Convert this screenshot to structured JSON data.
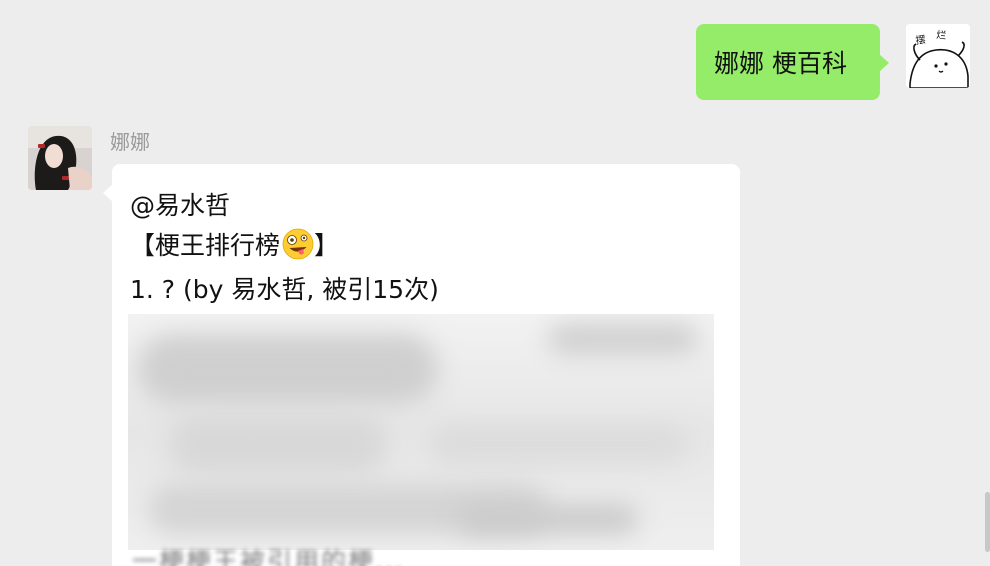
{
  "outgoing": {
    "text": "娜娜  梗百科",
    "avatar_label": "摆烂"
  },
  "incoming": {
    "sender_name": "娜娜",
    "line1": "@易水哲",
    "line2": "【梗王排行榜",
    "line2_emoji": "zany-face-emoji",
    "line2_end": "】",
    "line3": "1. ?  (by 易水哲, 被引15次)",
    "blurred_strip": "一梗梗王被引用的梗..."
  },
  "colors": {
    "background": "#ededed",
    "outgoing_bubble": "#95ec69",
    "incoming_bubble": "#ffffff",
    "name_text": "#9a9a9a"
  }
}
